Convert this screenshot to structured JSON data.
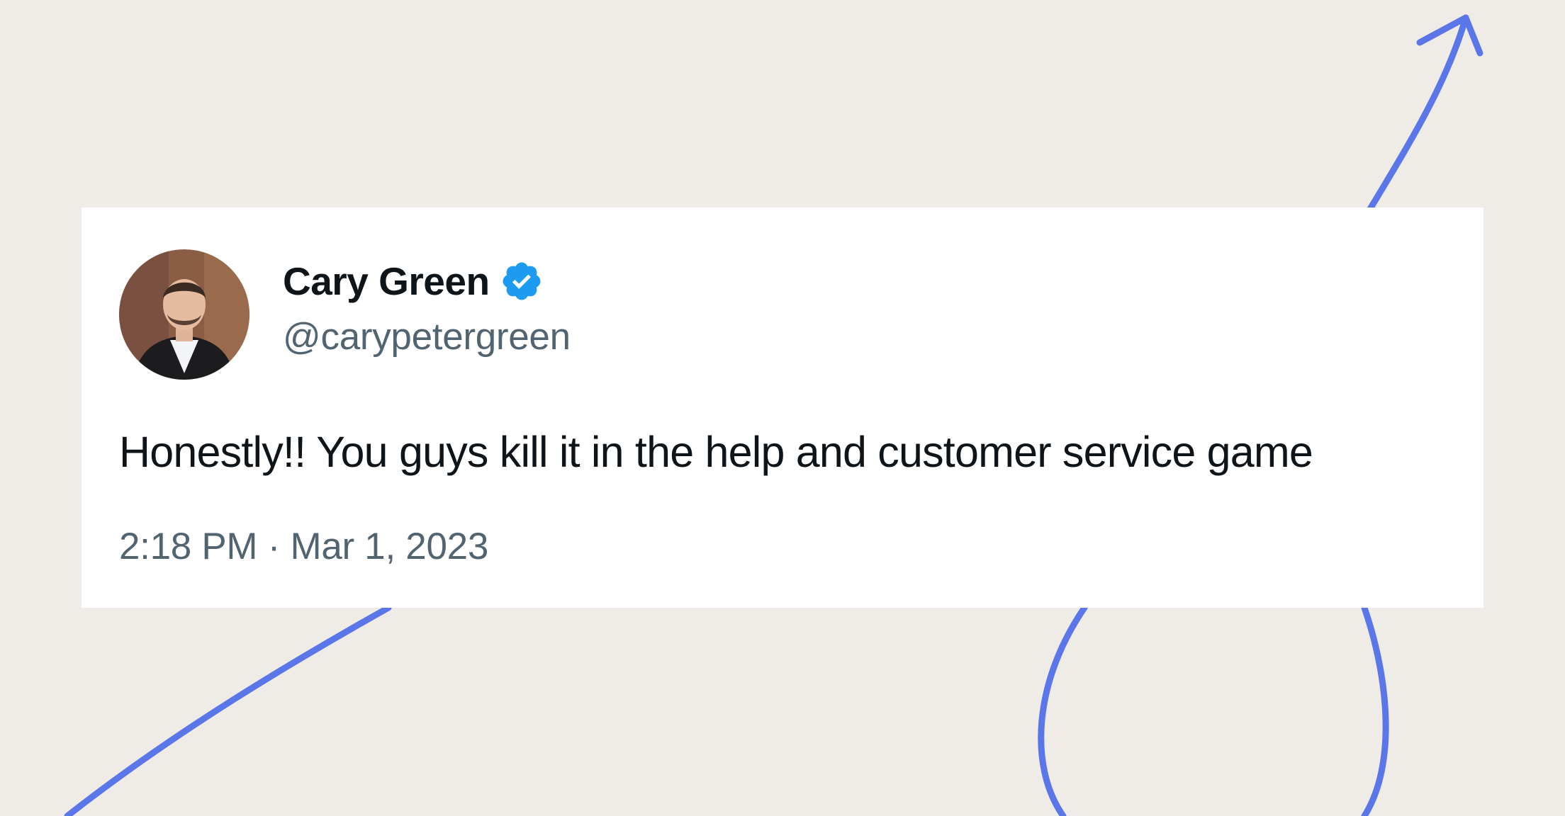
{
  "colors": {
    "background": "#efece8",
    "card": "#ffffff",
    "accent_line": "#5a76e8",
    "verified_badge": "#1d9bf0",
    "text_primary": "#0f1419",
    "text_secondary": "#536471"
  },
  "tweet": {
    "author": {
      "name": "Cary Green",
      "handle": "@carypetergreen",
      "verified": true,
      "avatar_icon": "profile-photo",
      "badge_icon": "verified-badge-icon"
    },
    "text": "Honestly!! You guys kill it in the help and customer service game",
    "time": "2:18 PM",
    "separator": " · ",
    "date": "Mar 1, 2023"
  }
}
